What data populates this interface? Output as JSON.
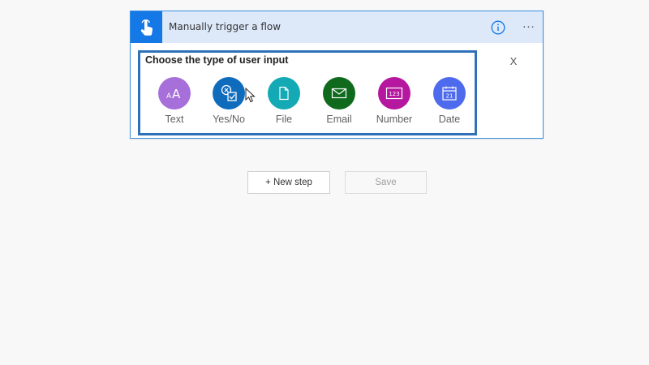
{
  "trigger": {
    "title": "Manually trigger a flow",
    "info_icon": "info-icon",
    "more_glyph": "···"
  },
  "selector": {
    "title": "Choose the type of user input",
    "close_label": "X",
    "options": [
      {
        "label": "Text",
        "icon": "text-icon",
        "color": "#a66fd9"
      },
      {
        "label": "Yes/No",
        "icon": "yes-no-icon",
        "color": "#0f6cbd"
      },
      {
        "label": "File",
        "icon": "file-icon",
        "color": "#13a9b5"
      },
      {
        "label": "Email",
        "icon": "email-icon",
        "color": "#0f6a1d"
      },
      {
        "label": "Number",
        "icon": "number-icon",
        "color": "#b5179e"
      },
      {
        "label": "Date",
        "icon": "calendar-icon",
        "color": "#4f6bed"
      }
    ]
  },
  "actions": {
    "new_step_label": "+ New step",
    "save_label": "Save"
  },
  "colors": {
    "accent": "#1478e6",
    "header_bg": "#dde9f9",
    "selection_border": "#2f70b8"
  }
}
